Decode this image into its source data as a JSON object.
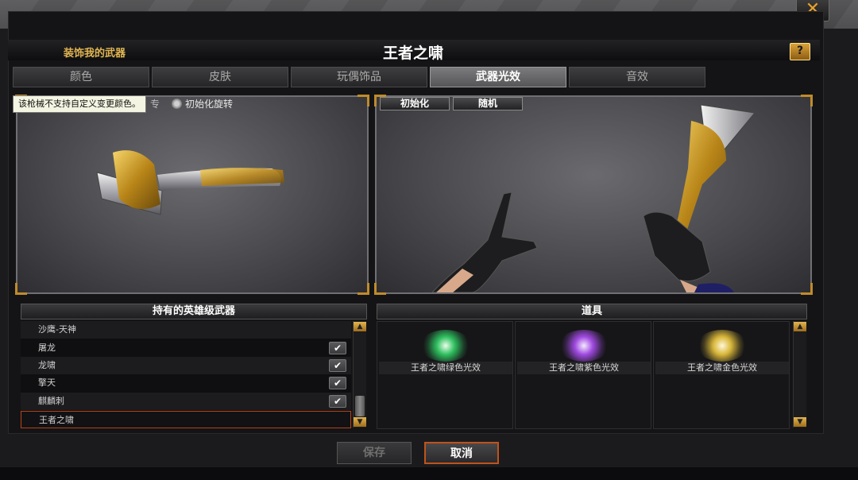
{
  "window": {
    "close_glyph": "✕",
    "left_title": "装饰我的武器",
    "title": "王者之啸",
    "help_glyph": "?"
  },
  "tabs": [
    {
      "label": "颜色",
      "active": false
    },
    {
      "label": "皮肤",
      "active": false
    },
    {
      "label": "玩偶饰品",
      "active": false
    },
    {
      "label": "武器光效",
      "active": true
    },
    {
      "label": "音效",
      "active": false
    }
  ],
  "left_viewport": {
    "tooltip": "该枪械不支持自定义变更颜色。",
    "partial_label": "专",
    "rotate_label": "初始化旋转",
    "swatches": [
      {
        "color": "#b4b4b8",
        "border": "#9a9a9a"
      },
      {
        "color": "#4a4a4c",
        "border": "#d23a2a"
      },
      {
        "color": "#1a1a1c",
        "border": "#bbbbbb"
      }
    ]
  },
  "right_viewport": {
    "reset_label": "初始化",
    "random_label": "随机"
  },
  "weapons_panel": {
    "header": "持有的英雄级武器",
    "items": [
      {
        "name": "沙鹰-天神",
        "checked": false
      },
      {
        "name": "屠龙",
        "checked": true
      },
      {
        "name": "龙啸",
        "checked": true
      },
      {
        "name": "擎天",
        "checked": true
      },
      {
        "name": "麒麟刺",
        "checked": true
      },
      {
        "name": "王者之啸",
        "checked": false,
        "selected": true
      }
    ]
  },
  "items_panel": {
    "header": "道具",
    "items": [
      {
        "label": "王者之啸绿色光效",
        "glow_color": "#2fbf5f"
      },
      {
        "label": "王者之啸紫色光效",
        "glow_color": "#a04ae0"
      },
      {
        "label": "王者之啸金色光效",
        "glow_color": "#d8b63a"
      }
    ]
  },
  "footer": {
    "save_label": "保存",
    "cancel_label": "取消"
  },
  "icons": {
    "check": "✔",
    "scroll_up": "▲",
    "scroll_down": "▼"
  }
}
